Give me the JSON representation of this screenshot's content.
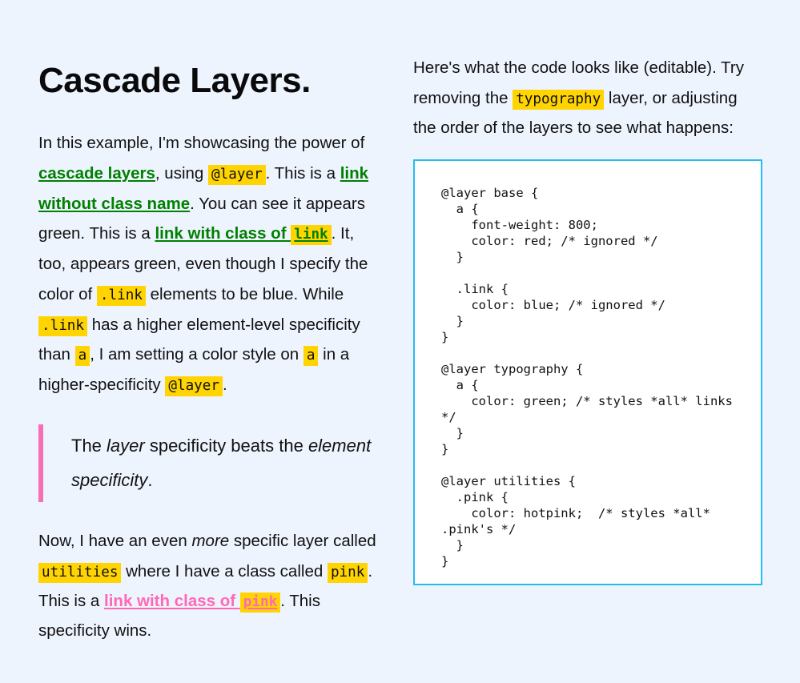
{
  "page": {
    "background_color": "#eef4fe",
    "heading": "Cascade Layers."
  },
  "colors": {
    "background": "#eef4fe",
    "code_highlight": "#ffd400",
    "green_link": "#008000",
    "pink_link": "#ff69b4",
    "quote_bar": "#f76fb3",
    "code_panel_border": "#25bdf0",
    "code_panel_background": "#ffffff",
    "text": "#111111"
  },
  "left_column": {
    "heading": "Cascade Layers.",
    "intro_parts": {
      "t1": "In this example, I'm showcasing the power of ",
      "link_cascade_layers": "cascade layers",
      "t2": ", using ",
      "code_atlayer_1": "@layer",
      "t3": ". This is a ",
      "link_without_class": "link without class name",
      "t4": ". You can see it appears green. This is a ",
      "link_with_class_of": "link with class of ",
      "code_link_1": "link",
      "t5": ". It, too, appears green, even though I specify the color of ",
      "code_dotlink_1": ".link",
      "t6": " elements to be blue. While ",
      "code_dotlink_2": ".link",
      "t7": " has a higher element-level specificity than ",
      "code_a_1": "a",
      "t8": ", I am setting a color style on ",
      "code_a_2": "a",
      "t9": " in a higher-specificity ",
      "code_atlayer_2": "@layer",
      "t10": "."
    },
    "quote": {
      "t1": "The ",
      "em1": "layer",
      "t2": " specificity beats the ",
      "em2": "element specificity",
      "t3": "."
    },
    "outro_parts": {
      "t1": "Now, I have an even ",
      "em1": "more",
      "t2": " specific layer called ",
      "code_utilities": "utilities",
      "t3": " where I have a class called ",
      "code_pink_1": "pink",
      "t4": ". This is a ",
      "link_with_class_of": "link with class of ",
      "code_pink_2": "pink",
      "t5": ". This specificity wins."
    }
  },
  "right_column": {
    "intro_parts": {
      "t1": "Here's what the code looks like (editable). Try removing the ",
      "code_typography": "typography",
      "t2": " layer, or adjusting the order of the layers to see what happens:"
    },
    "code_editor": {
      "editable": true,
      "language": "css",
      "content": "@layer base {\n  a {\n    font-weight: 800;\n    color: red; /* ignored */\n  }\n\n  .link {\n    color: blue; /* ignored */\n  }\n}\n\n@layer typography {\n  a {\n    color: green; /* styles *all* links */\n  }\n}\n\n@layer utilities {\n  .pink {\n    color: hotpink;  /* styles *all* .pink's */\n  }\n}"
    }
  }
}
